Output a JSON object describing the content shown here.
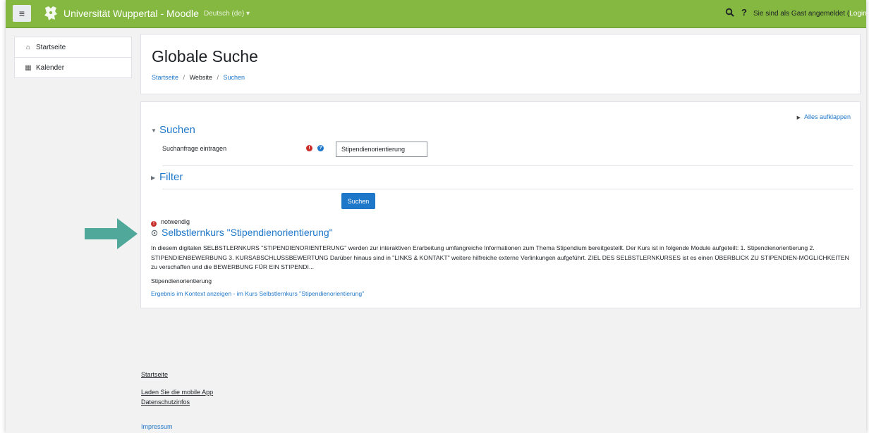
{
  "navbar": {
    "menu_icon": "hamburger-icon",
    "logo_icon": "university-lion-logo",
    "site_name": "Universität Wuppertal - Moodle",
    "language": "Deutsch (de)",
    "language_caret": "▾",
    "search_icon": "search-icon",
    "help_icon": "question-icon",
    "help_glyph": "?",
    "guest_text": "Sie sind als Gast angemeldet",
    "login_open": "(",
    "login_label": "Login",
    "login_close": ")",
    "colors": {
      "bar": "#84b840",
      "link": "#ffffff"
    }
  },
  "sidebar": {
    "items": [
      {
        "label": "Startseite",
        "icon": "home-icon",
        "glyph": "⌂"
      },
      {
        "label": "Kalender",
        "icon": "calendar-icon",
        "glyph": "▦"
      }
    ]
  },
  "header": {
    "title": "Globale Suche",
    "breadcrumb": [
      {
        "label": "Startseite",
        "link": true
      },
      {
        "label": "Website",
        "link": false
      },
      {
        "label": "Suchen",
        "link": true
      }
    ],
    "separator": "/"
  },
  "search": {
    "expand_all": "Alles aufklappen",
    "expand_all_icon": "triangle-right-icon",
    "section_search": "Suchen",
    "section_search_icon": "triangle-down-icon",
    "query_label": "Suchanfrage eintragen",
    "required_icon": "exclamation-circle-icon",
    "help_icon": "question-circle-icon",
    "query_value": "Stipendienorientierung",
    "section_filter": "Filter",
    "section_filter_icon": "triangle-right-icon",
    "submit_label": "Suchen",
    "required_note": "notwendig",
    "colors": {
      "link": "#1f77c9",
      "required": "#c9302c",
      "button": "#1f77c9"
    }
  },
  "result": {
    "icon": "course-icon",
    "title": "Selbstlernkurs \"Stipendienorientierung\"",
    "description": "In diesem digitalen SELBSTLERNKURS \"STIPENDIENORIENTERUNG\" werden zur interaktiven Erarbeitung umfangreiche Informationen zum Thema Stipendium bereitgestellt. Der Kurs ist in folgende Module aufgeteilt: 1. Stipendienorientierung 2. STIPENDIENBEWERBUNG 3. KURSABSCHLUSSBEWERTUNG Darüber hinaus sind in \"LINKS & KONTAKT\" weitere hilfreiche externe Verlinkungen aufgeführt. ZIEL DES SELBSTLERNKURSES ist es einen ÜBERBLICK ZU STIPENDIEN-MÖGLICHKEITEN zu verschaffen und die BEWERBUNG FÜR EIN STIPENDI...",
    "category": "Stipendienorientierung",
    "context_link": "Ergebnis im Kontext anzeigen - im Kurs Selbstlernkurs \"Stipendienorientierung\""
  },
  "annotation": {
    "icon": "arrow-right-icon",
    "color": "#4fa89a"
  },
  "footer": {
    "home": "Startseite",
    "mobile_app": "Laden Sie die mobile App",
    "privacy": "Datenschutzinfos",
    "imprint": "Impressum"
  }
}
